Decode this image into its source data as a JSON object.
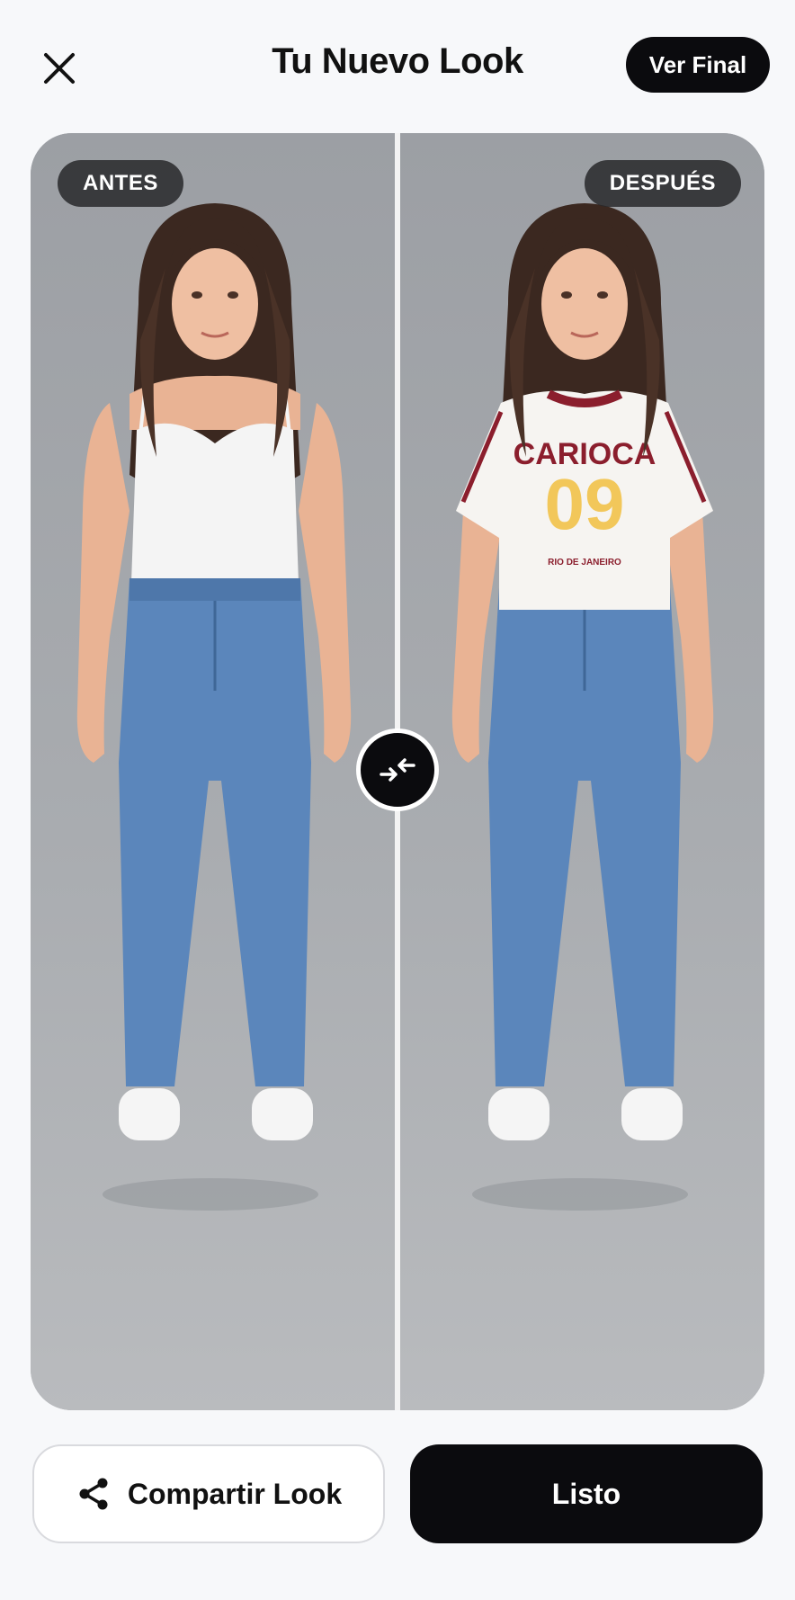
{
  "header": {
    "title": "Tu Nuevo Look",
    "final_button": "Ver Final"
  },
  "comparison": {
    "before_label": "ANTES",
    "after_label": "DESPUÉS",
    "shirt": {
      "text_top": "CARIOCA",
      "number": "09",
      "text_bottom": "RIO DE JANEIRO"
    }
  },
  "actions": {
    "share_label": "Compartir Look",
    "done_label": "Listo"
  },
  "colors": {
    "primary": "#0b0b0e",
    "shirt_accent": "#8b1e2d",
    "number_yellow": "#f2c75a",
    "denim": "#5b86bb"
  }
}
